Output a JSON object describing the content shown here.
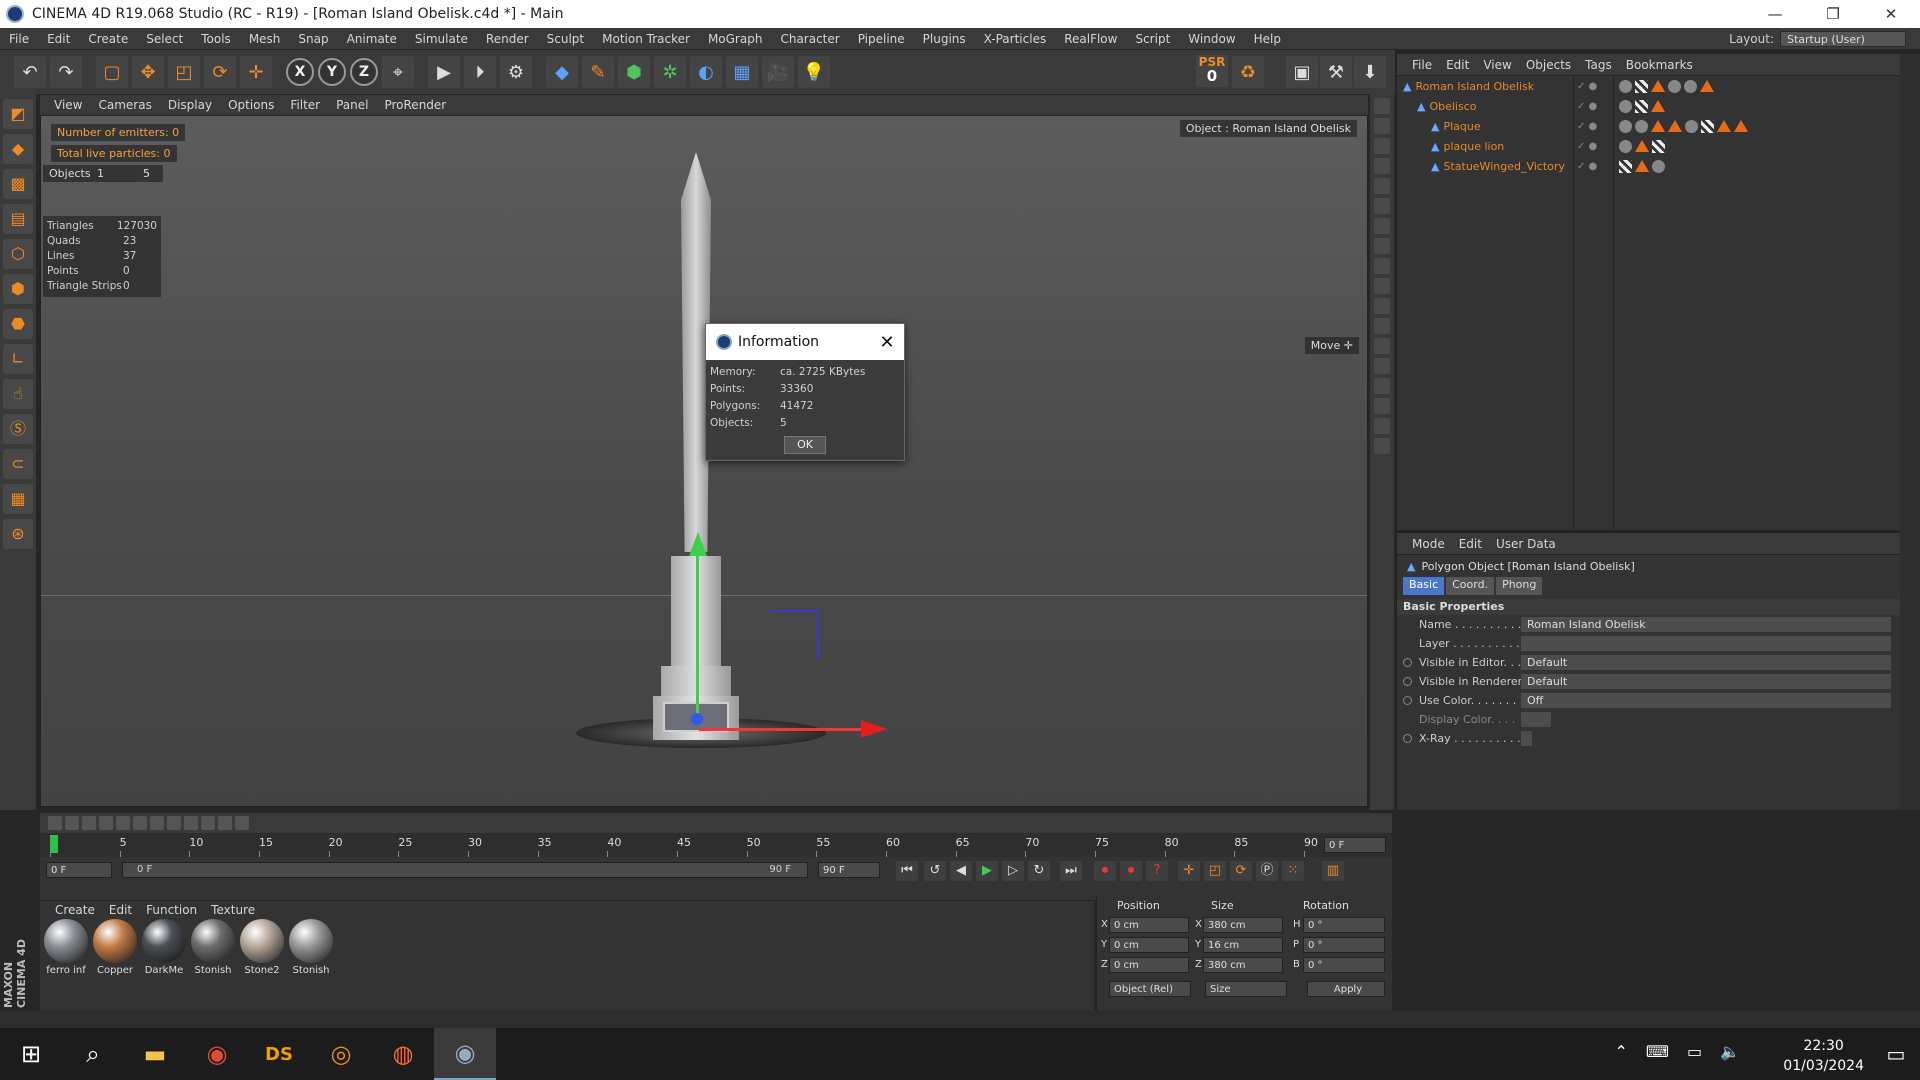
{
  "window": {
    "title": "CINEMA 4D R19.068 Studio (RC - R19) - [Roman Island Obelisk.c4d *] - Main",
    "min": "—",
    "max": "❐",
    "close": "✕"
  },
  "menu": [
    "File",
    "Edit",
    "Create",
    "Select",
    "Tools",
    "Mesh",
    "Snap",
    "Animate",
    "Simulate",
    "Render",
    "Sculpt",
    "Motion Tracker",
    "MoGraph",
    "Character",
    "Pipeline",
    "Plugins",
    "X-Particles",
    "RealFlow",
    "Script",
    "Window",
    "Help"
  ],
  "layout": {
    "label": "Layout:",
    "value": "Startup (User)"
  },
  "psr": {
    "label": "PSR",
    "value": "0"
  },
  "toolbar": {
    "x": "X",
    "y": "Y",
    "z": "Z"
  },
  "viewport_menu": [
    "View",
    "Cameras",
    "Display",
    "Options",
    "Filter",
    "Panel",
    "ProRender"
  ],
  "hud": {
    "emitters": "Number of emitters: 0",
    "particles": "Total live particles: 0",
    "objects_label": "Objects",
    "objects_a": "1",
    "objects_b": "5",
    "stats": [
      {
        "k": "Triangles",
        "v": "127030"
      },
      {
        "k": "Quads",
        "v": "23"
      },
      {
        "k": "Lines",
        "v": "37"
      },
      {
        "k": "Points",
        "v": "0"
      },
      {
        "k": "Triangle Strips",
        "v": "0"
      }
    ],
    "object_label": "Object : Roman Island Obelisk",
    "move_label": "Move ✛"
  },
  "dialog": {
    "title": "Information",
    "close": "✕",
    "rows": [
      {
        "k": "Memory:",
        "v": "ca. 2725 KBytes"
      },
      {
        "k": "Points:",
        "v": "33360"
      },
      {
        "k": "Polygons:",
        "v": "41472"
      },
      {
        "k": "Objects:",
        "v": "5"
      }
    ],
    "ok": "OK"
  },
  "object_manager": {
    "menu": [
      "File",
      "Edit",
      "View",
      "Objects",
      "Tags",
      "Bookmarks"
    ],
    "objects": [
      {
        "name": "Roman Island Obelisk",
        "indent": 0
      },
      {
        "name": "Obelisco",
        "indent": 1
      },
      {
        "name": "Plaque",
        "indent": 2
      },
      {
        "name": "plaque lion",
        "indent": 2
      },
      {
        "name": "StatueWinged_Victory",
        "indent": 2
      }
    ]
  },
  "attribute_manager": {
    "menu": [
      "Mode",
      "Edit",
      "User Data"
    ],
    "title": "Polygon Object [Roman Island Obelisk]",
    "tabs": [
      "Basic",
      "Coord.",
      "Phong"
    ],
    "section": "Basic Properties",
    "rows": [
      {
        "k": "Name . . . . . . . . . . . .",
        "v": "Roman Island Obelisk"
      },
      {
        "k": "Layer . . . . . . . . . . . .",
        "v": ""
      },
      {
        "k": "Visible in Editor. . .",
        "v": "Default"
      },
      {
        "k": "Visible in Renderer",
        "v": "Default"
      },
      {
        "k": "Use Color. . . . . . . .",
        "v": "Off"
      },
      {
        "k": "Display Color. . . .",
        "v": ""
      },
      {
        "k": "X-Ray . . . . . . . . . . .",
        "v": ""
      }
    ]
  },
  "timeline": {
    "ticks": [
      "0",
      "5",
      "10",
      "15",
      "20",
      "25",
      "30",
      "35",
      "40",
      "45",
      "50",
      "55",
      "60",
      "65",
      "70",
      "75",
      "80",
      "85",
      "90"
    ],
    "current": "0 F",
    "start": "0 F",
    "range_start": "0 F",
    "range_end": "90 F",
    "end": "90 F"
  },
  "materials": {
    "menu": [
      "Create",
      "Edit",
      "Function",
      "Texture"
    ],
    "items": [
      {
        "name": "ferro inf",
        "color": "#8a8f96"
      },
      {
        "name": "Copper",
        "color": "#c27c47"
      },
      {
        "name": "DarkMe",
        "color": "#4a4e55"
      },
      {
        "name": "Stonish",
        "color": "#6d6d6d"
      },
      {
        "name": "Stone2",
        "color": "#b5a89a"
      },
      {
        "name": "Stonish",
        "color": "#9a9a9a"
      }
    ]
  },
  "coords": {
    "headers": [
      "Position",
      "Size",
      "Rotation"
    ],
    "rows": [
      {
        "axis": "X",
        "pos": "0 cm",
        "saxis": "X",
        "size": "380 cm",
        "raxis": "H",
        "rot": "0 °"
      },
      {
        "axis": "Y",
        "pos": "0 cm",
        "saxis": "Y",
        "size": "16 cm",
        "raxis": "P",
        "rot": "0 °"
      },
      {
        "axis": "Z",
        "pos": "0 cm",
        "saxis": "Z",
        "size": "380 cm",
        "raxis": "B",
        "rot": "0 °"
      }
    ],
    "mode": "Object (Rel)",
    "size_mode": "Size",
    "apply": "Apply"
  },
  "brand": "MAXON CINEMA 4D",
  "taskbar": {
    "time": "22:30",
    "date": "01/03/2024"
  }
}
